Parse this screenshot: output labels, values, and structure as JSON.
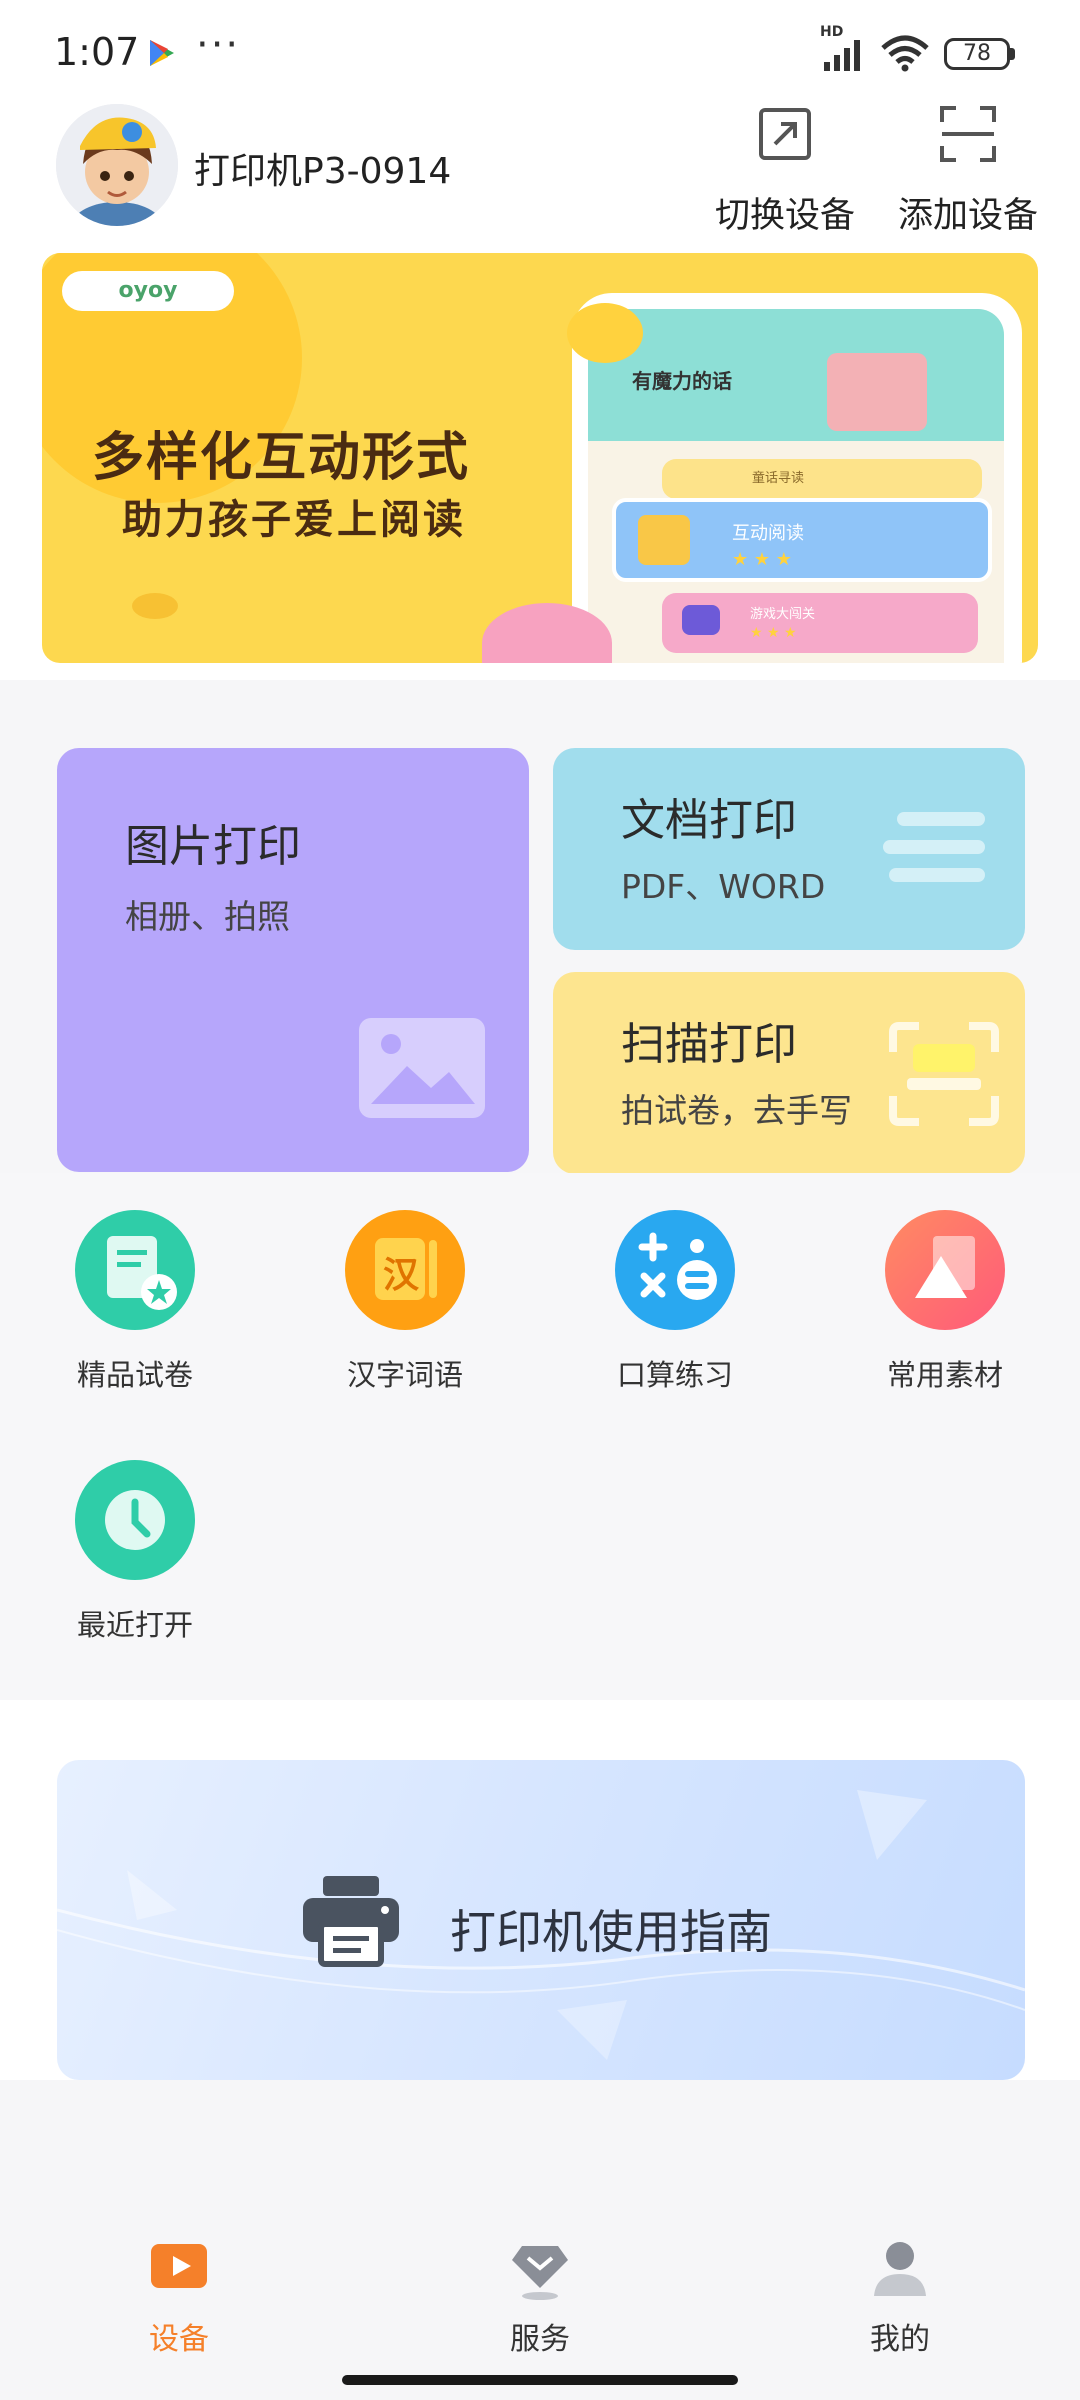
{
  "status_bar": {
    "time": "1:07",
    "dots": "···",
    "hd": "HD",
    "battery": "78"
  },
  "header": {
    "device_name": "打印机P3-0914",
    "switch_device_label": "切换设备",
    "add_device_label": "添加设备"
  },
  "banner": {
    "logo_text": "oyoy",
    "title": "多样化互动形式",
    "subtitle": "助力孩子爱上阅读",
    "phone_title": "有魔力的话",
    "row_top_label": "童话寻读",
    "row_middle_label": "互动阅读",
    "row_bottom_label": "游戏大闯关"
  },
  "features": {
    "photo": {
      "title": "图片打印",
      "subtitle": "相册、拍照"
    },
    "document": {
      "title": "文档打印",
      "subtitle": "PDF、WORD"
    },
    "scan": {
      "title": "扫描打印",
      "subtitle": "拍试卷，去手写"
    }
  },
  "shortcuts": [
    {
      "label": "精品试卷",
      "icon": "exam-paper-icon",
      "color": "#2fcda8"
    },
    {
      "label": "汉字词语",
      "icon": "chinese-character-icon",
      "color": "#ffa012",
      "glyph": "汉"
    },
    {
      "label": "口算练习",
      "icon": "math-practice-icon",
      "color": "#29a8f0"
    },
    {
      "label": "常用素材",
      "icon": "materials-icon",
      "color": "#ff6f6f"
    },
    {
      "label": "最近打开",
      "icon": "recent-clock-icon",
      "color": "#2fcda8"
    }
  ],
  "guide": {
    "label": "打印机使用指南"
  },
  "tabbar": {
    "items": [
      {
        "label": "设备",
        "active": true
      },
      {
        "label": "服务",
        "active": false
      },
      {
        "label": "我的",
        "active": false
      }
    ],
    "active_color": "#f5802a",
    "inactive_color": "#333333"
  }
}
